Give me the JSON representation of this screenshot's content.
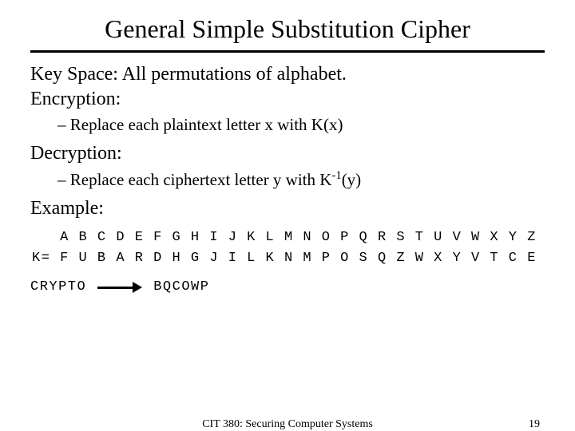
{
  "title": "General Simple Substitution Cipher",
  "body": {
    "keyspace_line": "Key Space: All permutations of alphabet.",
    "encryption_label": "Encryption:",
    "encryption_detail": "– Replace each plaintext letter x with K(x)",
    "decryption_label": "Decryption:",
    "decryption_detail_pre": "– Replace each ciphertext letter y with K",
    "decryption_detail_sup": "-1",
    "decryption_detail_post": "(y)",
    "example_label": "Example:"
  },
  "cipher_table": {
    "alphabet_row": "   A B C D E F G H I J K L M N O P Q R S T U V W X Y Z",
    "key_row": "K= F U B A R D H G J I L K N M P O S Q Z W X Y V T C E"
  },
  "example_pair": {
    "plain": "CRYPTO",
    "cipher": "BQCOWP"
  },
  "footer": {
    "course": "CIT 380: Securing Computer Systems",
    "page": "19"
  }
}
